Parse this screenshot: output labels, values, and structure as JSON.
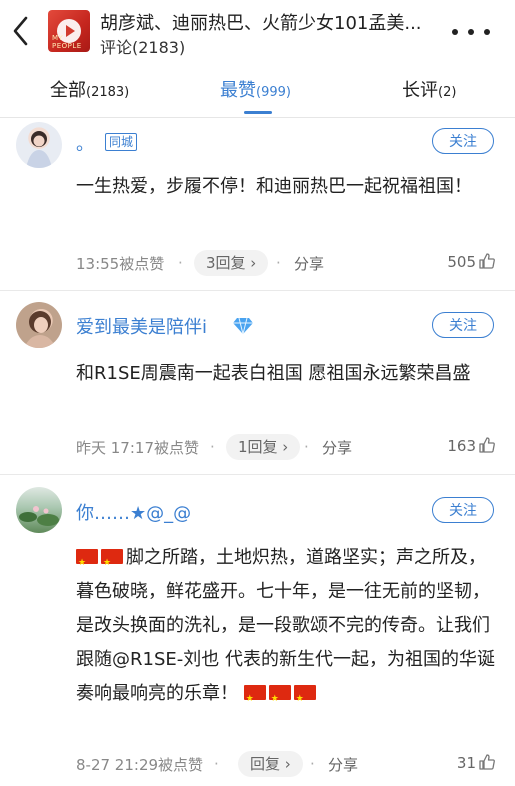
{
  "header": {
    "title": "胡彦斌、迪丽热巴、火箭少女101孟美...",
    "subtitle": "评论(2183)",
    "cover_tag": "MY PEOPLE"
  },
  "tabs": [
    {
      "label": "全部",
      "count": "(2183)",
      "active": false
    },
    {
      "label": "最赞",
      "count": "(999)",
      "active": true
    },
    {
      "label": "长评",
      "count": "(2)",
      "active": false
    }
  ],
  "colors": {
    "accent": "#3b7fd1",
    "text": "#222222",
    "meta": "#888888",
    "flag": "#de2910"
  },
  "comments": [
    {
      "username": "。",
      "badge": "同城",
      "follow_label": "关注",
      "text": "一生热爱，步履不停！和迪丽热巴一起祝福祖国！",
      "time": "13:55被点赞",
      "reply": "3回复 ›",
      "share": "分享",
      "likes": "505"
    },
    {
      "username": "爱到最美是陪伴i",
      "badge_icon": "diamond-vip-icon",
      "follow_label": "关注",
      "text": "和R1SE周震南一起表白祖国 愿祖国永远繁荣昌盛",
      "time": "昨天 17:17被点赞",
      "reply": "1回复 ›",
      "share": "分享",
      "likes": "163"
    },
    {
      "username": "你……★@_@",
      "follow_label": "关注",
      "text": "脚之所踏，土地炽热，道路坚实；声之所及，暮色破晓，鲜花盛开。七十年，是一往无前的坚韧，是改头换面的洗礼，是一段歌颂不完的传奇。让我们跟随@R1SE-刘也 代表的新生代一起，为祖国的华诞奏响最响亮的乐章！",
      "time": "8-27 21:29被点赞",
      "reply": "回复 ›",
      "share": "分享",
      "likes": "31"
    }
  ]
}
